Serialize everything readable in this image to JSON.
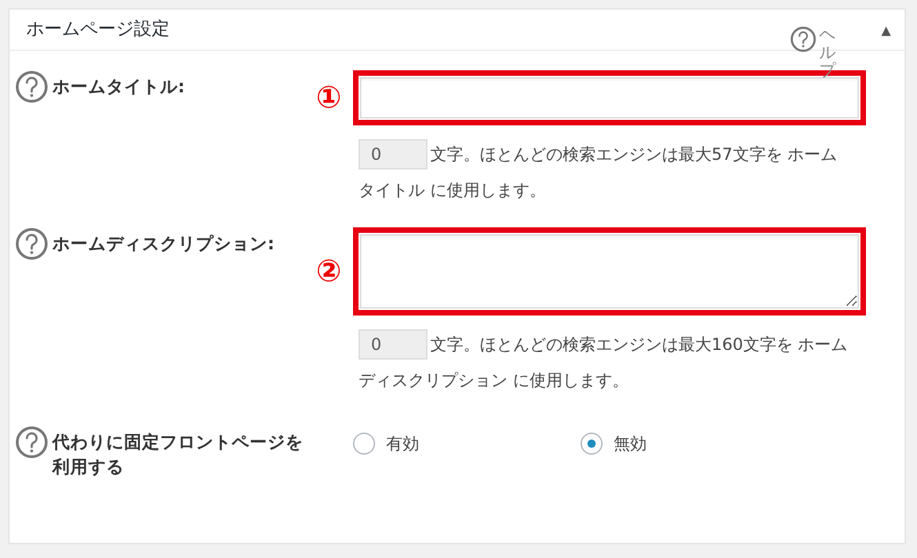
{
  "panel": {
    "title": "ホームページ設定",
    "help_link": "ヘルプ",
    "collapse_toggle": "▲"
  },
  "fields": [
    {
      "kind": "text",
      "label": "ホームタイトル:",
      "marker": "①",
      "count": "0",
      "hint_lines": [
        "文字。ほとんどの検索エンジンは最大57文字を ホーム",
        "タイトル に使用します。"
      ]
    },
    {
      "kind": "textarea",
      "label": "ホームディスクリプション:",
      "marker": "②",
      "count": "0",
      "hint_lines": [
        "文字。ほとんどの検索エンジンは最大160文字を ホーム",
        "ディスクリプション に使用します。"
      ]
    },
    {
      "kind": "radio",
      "label": "代わりに固定フロントページを利用する",
      "options": [
        {
          "label": "有効",
          "selected": false
        },
        {
          "label": "無効",
          "selected": true
        }
      ]
    }
  ]
}
